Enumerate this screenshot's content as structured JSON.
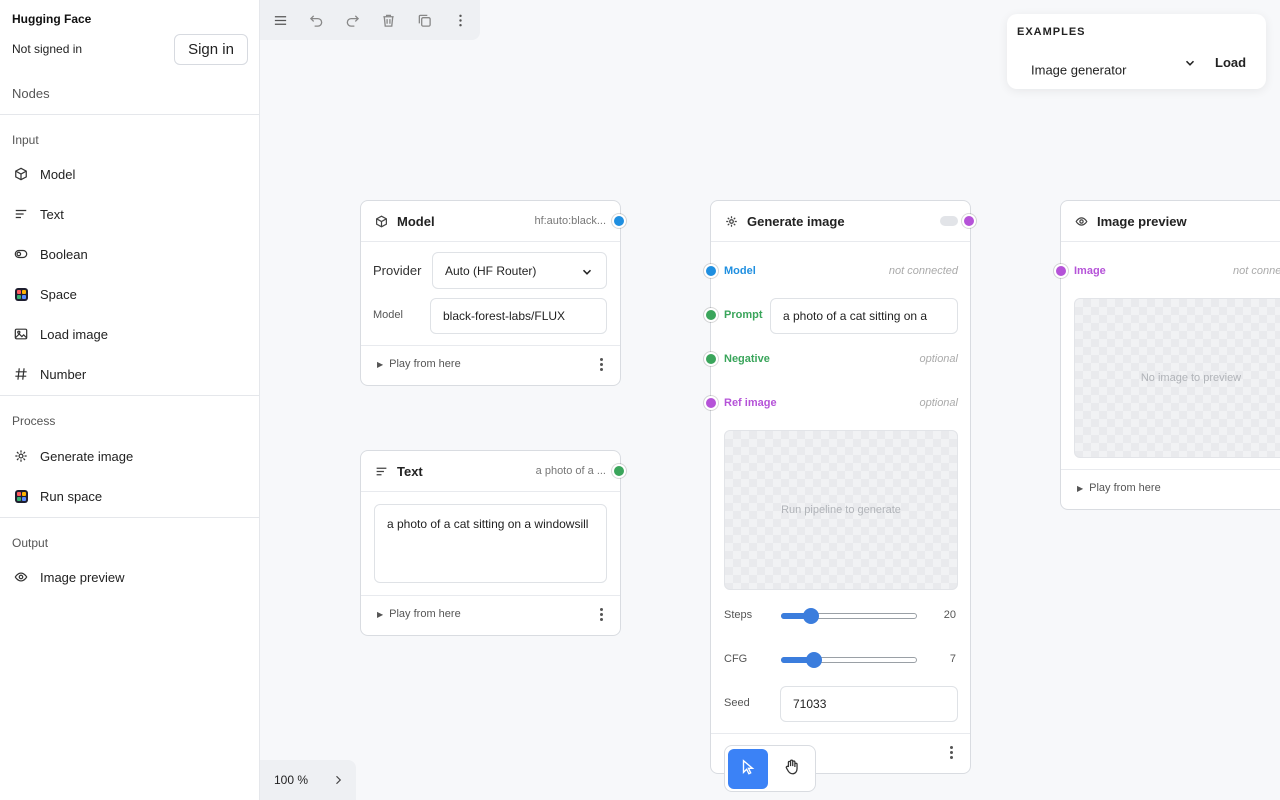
{
  "sidebar": {
    "brand": "Hugging Face",
    "status": "Not signed in",
    "sign_in": "Sign in",
    "nodes_heading": "Nodes",
    "sections": {
      "input": "Input",
      "process": "Process",
      "output": "Output"
    },
    "items": [
      {
        "label": "Model",
        "icon": "cube-icon"
      },
      {
        "label": "Text",
        "icon": "text-lines-icon"
      },
      {
        "label": "Boolean",
        "icon": "toggle-icon"
      },
      {
        "label": "Space",
        "icon": "space-logo-icon"
      },
      {
        "label": "Load image",
        "icon": "image-icon"
      },
      {
        "label": "Number",
        "icon": "hash-icon"
      },
      {
        "label": "Generate image",
        "icon": "sparkle-icon"
      },
      {
        "label": "Run space",
        "icon": "space-logo-icon"
      },
      {
        "label": "Image preview",
        "icon": "eye-icon"
      }
    ]
  },
  "toolbar": {
    "icons": [
      "menu-icon",
      "undo-icon",
      "redo-icon",
      "delete-icon",
      "duplicate-icon",
      "more-icon"
    ]
  },
  "examples": {
    "title": "EXAMPLES",
    "selected": "Image generator",
    "load": "Load"
  },
  "nodes": {
    "model": {
      "title": "Model",
      "subtitle": "hf:auto:black...",
      "provider_label": "Provider",
      "provider_value": "Auto (HF Router)",
      "model_label": "Model",
      "model_value": "black-forest-labs/FLUX",
      "play": "Play from here"
    },
    "text": {
      "title": "Text",
      "subtitle": "a photo of a ...",
      "value": "a photo of a cat sitting on a windowsill",
      "play": "Play from here"
    },
    "generate": {
      "title": "Generate image",
      "inputs": [
        {
          "label": "Model",
          "hint": "not connected",
          "color": "#1f8fe0"
        },
        {
          "label": "Prompt",
          "value": "a photo of a cat sitting on a",
          "color": "#3aa55b"
        },
        {
          "label": "Negative",
          "hint": "optional",
          "color": "#3aa55b"
        },
        {
          "label": "Ref image",
          "hint": "optional",
          "color": "#b553d8"
        }
      ],
      "placeholder": "Run pipeline to generate",
      "steps_label": "Steps",
      "steps_value": "20",
      "steps_fraction": 0.22,
      "cfg_label": "CFG",
      "cfg_value": "7",
      "cfg_fraction": 0.24,
      "seed_label": "Seed",
      "seed_value": "71033"
    },
    "preview": {
      "title": "Image preview",
      "input_label": "Image",
      "input_hint": "not connected",
      "placeholder": "No image to preview",
      "play": "Play from here"
    }
  },
  "zoom": "100 %",
  "colors": {
    "model_port": "#1f8fe0",
    "text_port": "#3aa55b",
    "image_port": "#b553d8",
    "accent": "#3b82f6"
  }
}
